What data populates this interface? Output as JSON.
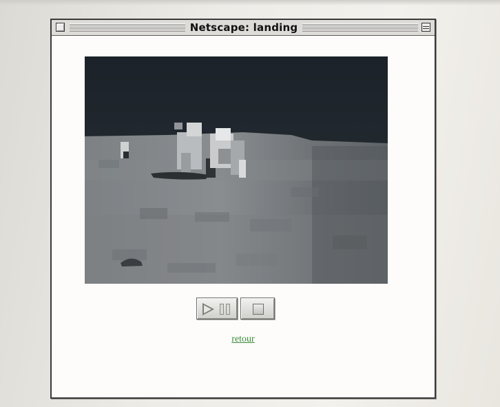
{
  "window": {
    "title": "Netscape: landing"
  },
  "video": {
    "description_icon": "moon-landing-video-frame"
  },
  "controls": {
    "play_pause_icon": "play-pause-icon",
    "stop_icon": "stop-icon"
  },
  "link": {
    "retour": "retour"
  },
  "colors": {
    "link": "#3a8a3a",
    "window_border": "#3a3a3a",
    "titlebar": "#dedcd8"
  }
}
